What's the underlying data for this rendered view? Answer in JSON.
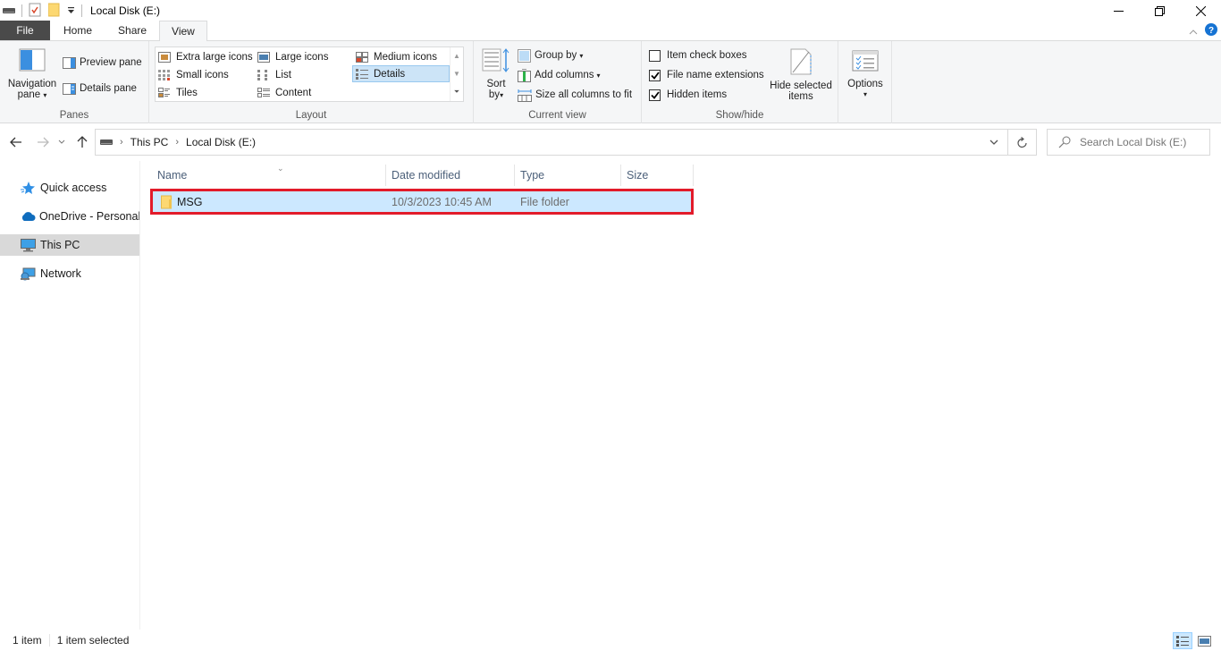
{
  "window": {
    "title": "Local Disk (E:)",
    "controls": {
      "minimize": "minimize",
      "maximize": "restore",
      "close": "close"
    }
  },
  "tabs": [
    {
      "label": "File"
    },
    {
      "label": "Home"
    },
    {
      "label": "Share"
    },
    {
      "label": "View"
    }
  ],
  "ribbon": {
    "panes": {
      "label": "Panes",
      "navigation_pane": "Navigation pane",
      "navigation_pane_l1": "Navigation",
      "navigation_pane_l2": "pane",
      "preview_pane": "Preview pane",
      "details_pane": "Details pane"
    },
    "layout": {
      "label": "Layout",
      "items": [
        {
          "label": "Extra large icons"
        },
        {
          "label": "Large icons"
        },
        {
          "label": "Medium icons"
        },
        {
          "label": "Small icons"
        },
        {
          "label": "List"
        },
        {
          "label": "Details",
          "selected": true
        },
        {
          "label": "Tiles"
        },
        {
          "label": "Content"
        }
      ]
    },
    "current_view": {
      "label": "Current view",
      "sort_by_l1": "Sort",
      "sort_by_l2": "by",
      "group_by": "Group by",
      "add_columns": "Add columns",
      "size_all_columns": "Size all columns to fit"
    },
    "show_hide": {
      "label": "Show/hide",
      "item_check_boxes": {
        "label": "Item check boxes",
        "checked": false
      },
      "file_name_extensions": {
        "label": "File name extensions",
        "checked": true
      },
      "hidden_items": {
        "label": "Hidden items",
        "checked": true
      },
      "hide_selected_l1": "Hide selected",
      "hide_selected_l2": "items"
    },
    "options": {
      "label": "Options"
    }
  },
  "address": {
    "breadcrumbs": [
      "This PC",
      "Local Disk (E:)"
    ],
    "search_placeholder": "Search Local Disk (E:)"
  },
  "navpane": {
    "items": [
      {
        "label": "Quick access"
      },
      {
        "label": "OneDrive - Personal"
      },
      {
        "label": "This PC",
        "selected": true
      },
      {
        "label": "Network"
      }
    ]
  },
  "files": {
    "columns": [
      "Name",
      "Date modified",
      "Type",
      "Size"
    ],
    "rows": [
      {
        "name": "MSG",
        "date_modified": "10/3/2023 10:45 AM",
        "type": "File folder",
        "size": "",
        "selected": true
      }
    ]
  },
  "status": {
    "item_count": "1 item",
    "selection": "1 item selected"
  },
  "colors": {
    "selection": "#cce8ff",
    "highlight_border": "#e21b2a",
    "file_tab": "#4a4a4a",
    "accent_blue": "#0078d7"
  }
}
